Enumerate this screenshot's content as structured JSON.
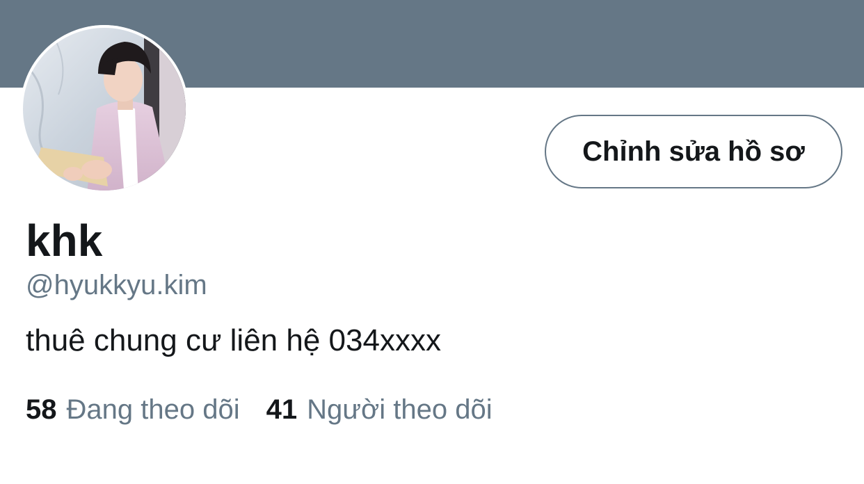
{
  "profile": {
    "display_name": "khk",
    "handle": "@hyukkyu.kim",
    "bio": "thuê chung cư liên hệ 034xxxx",
    "edit_button_label": "Chỉnh sửa hồ sơ",
    "avatar_icon": "user-photo-icon",
    "stats": {
      "following_count": "58",
      "following_label": "Đang theo dõi",
      "followers_count": "41",
      "followers_label": "Người theo dõi"
    }
  },
  "colors": {
    "banner": "#657786",
    "text_primary": "#14171a",
    "text_secondary": "#657786",
    "button_border": "#657786"
  }
}
